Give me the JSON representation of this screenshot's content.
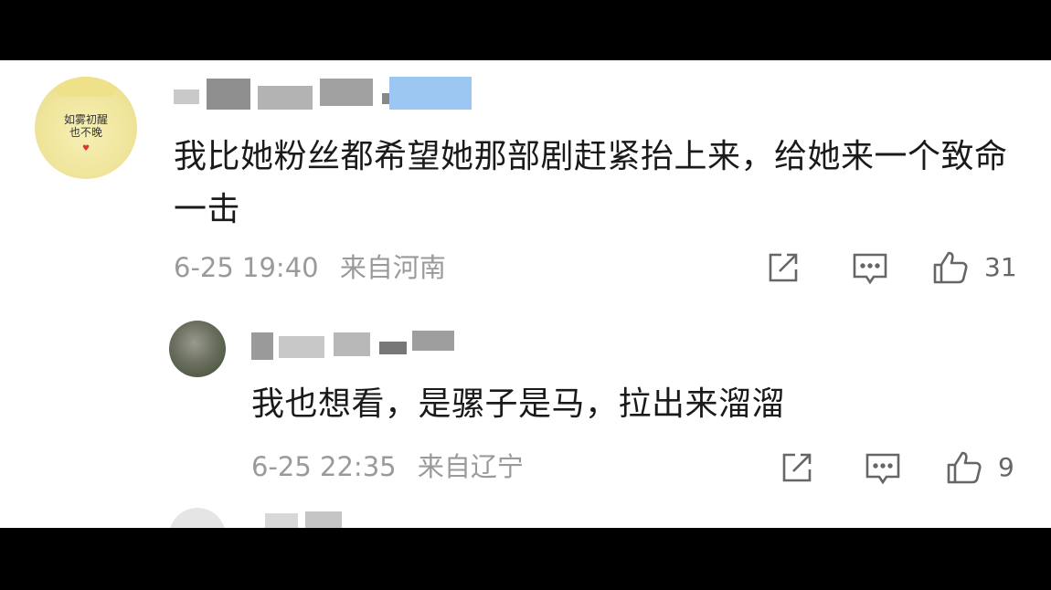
{
  "comments": [
    {
      "text": "我比她粉丝都希望她那部剧赶紧抬上来，给她来一个致命一击",
      "date": "6-25 19:40",
      "location": "来自河南",
      "likes": "31",
      "avatar_lines": [
        "如雾初醒",
        "也不晚"
      ],
      "avatar_heart": "♥"
    },
    {
      "text": "我也想看，是骡子是马，拉出来溜溜",
      "date": "6-25 22:35",
      "location": "来自辽宁",
      "likes": "9"
    }
  ],
  "icons": [
    "share-icon",
    "comment-icon",
    "like-icon"
  ],
  "colors": {
    "background": "#ffffff",
    "frame": "#000000",
    "text": "#1a1a1a",
    "meta": "#9a9a9a",
    "icon": "#666666"
  }
}
